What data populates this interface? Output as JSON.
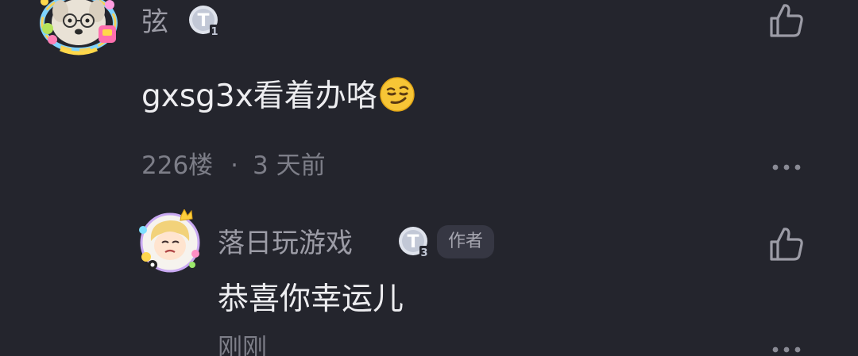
{
  "comment": {
    "username": "弦",
    "level_badge": "T1",
    "text": "gxsg3x看着办咯",
    "emoji": "smirking-face-emoji",
    "floor": "226楼",
    "separator": "·",
    "time": "3 天前",
    "like_icon": "thumbs-up-icon",
    "more_icon": "more-dots-icon"
  },
  "reply": {
    "username": "落日玩游戏",
    "level_badge": "T3",
    "author_tag": "作者",
    "text": "恭喜你幸运儿",
    "time": "刚刚",
    "like_icon": "thumbs-up-icon",
    "more_icon": "more-dots-icon"
  },
  "colors": {
    "background": "#24252d",
    "text_primary": "#ededf0",
    "text_secondary": "#9c9ca6",
    "text_meta": "#7d7e88",
    "tag_background": "#363743"
  }
}
